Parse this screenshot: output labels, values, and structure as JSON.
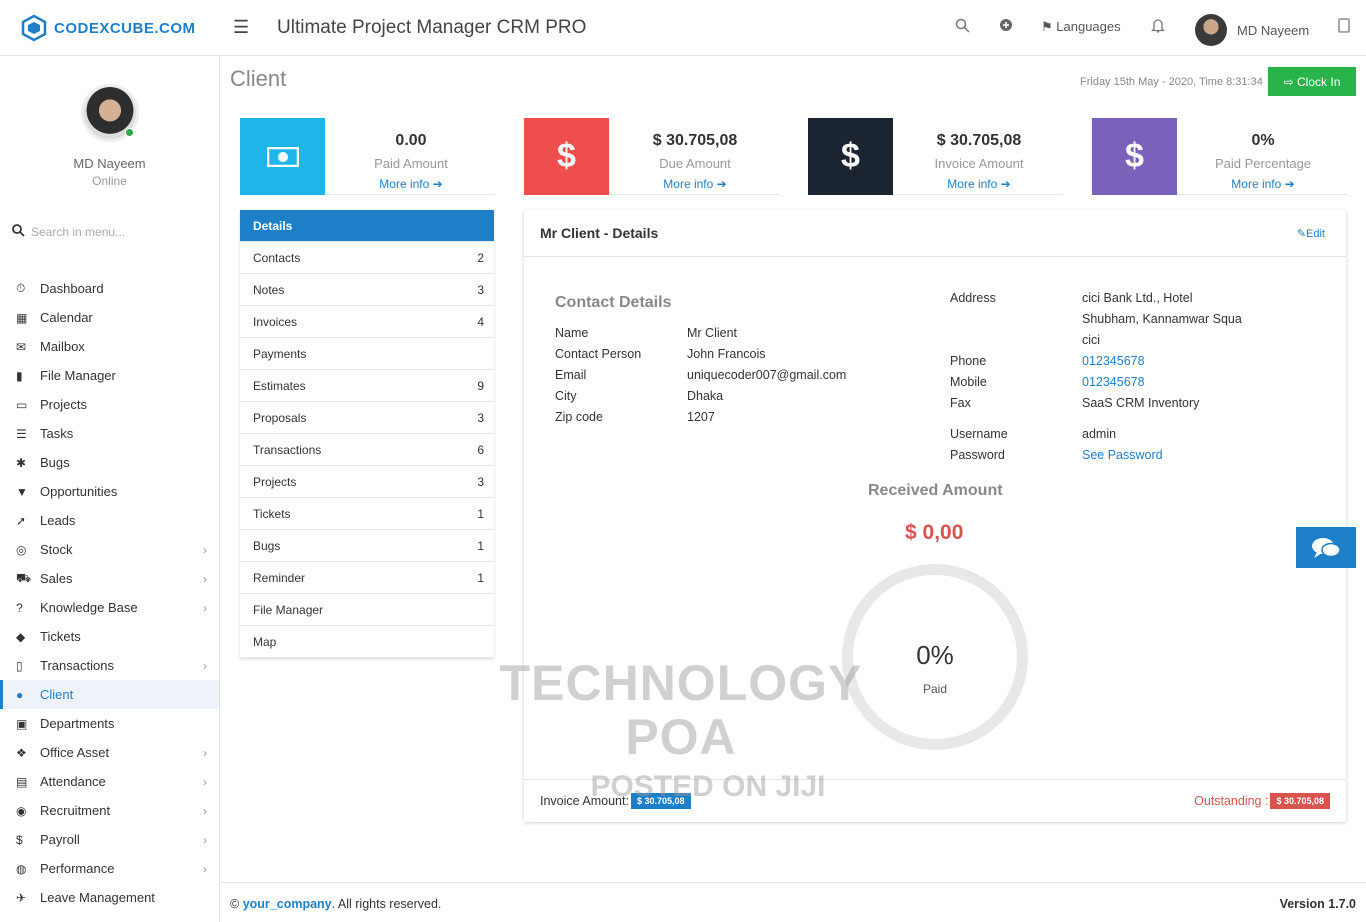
{
  "header": {
    "logo_text": "CODEXCUBE.COM",
    "app_title": "Ultimate Project Manager CRM PRO",
    "languages_label": "Languages",
    "user_name": "MD Nayeem"
  },
  "sidebar": {
    "profile_name": "MD Nayeem",
    "profile_status": "Online",
    "search_placeholder": "Search in menu...",
    "items": [
      {
        "label": "Dashboard",
        "icon": "dashboard-icon"
      },
      {
        "label": "Calendar",
        "icon": "calendar-icon"
      },
      {
        "label": "Mailbox",
        "icon": "mail-icon"
      },
      {
        "label": "File Manager",
        "icon": "file-icon"
      },
      {
        "label": "Projects",
        "icon": "folder-icon"
      },
      {
        "label": "Tasks",
        "icon": "tasks-icon"
      },
      {
        "label": "Bugs",
        "icon": "bug-icon"
      },
      {
        "label": "Opportunities",
        "icon": "filter-icon"
      },
      {
        "label": "Leads",
        "icon": "rocket-icon"
      },
      {
        "label": "Stock",
        "icon": "database-icon"
      },
      {
        "label": "Sales",
        "icon": "cart-icon"
      },
      {
        "label": "Knowledge Base",
        "icon": "question-icon"
      },
      {
        "label": "Tickets",
        "icon": "ticket-icon"
      },
      {
        "label": "Transactions",
        "icon": "building-icon"
      },
      {
        "label": "Client",
        "icon": "users-icon"
      },
      {
        "label": "Departments",
        "icon": "lock-icon"
      },
      {
        "label": "Office Asset",
        "icon": "cube-icon"
      },
      {
        "label": "Attendance",
        "icon": "document-icon"
      },
      {
        "label": "Recruitment",
        "icon": "globe-icon"
      },
      {
        "label": "Payroll",
        "icon": "dollar-icon"
      },
      {
        "label": "Performance",
        "icon": "gauge-icon"
      },
      {
        "label": "Leave Management",
        "icon": "plane-icon"
      }
    ]
  },
  "page": {
    "title": "Client",
    "datetime": "Friday 15th May - 2020,  Time  8:31:34",
    "clockin_label": "Clock In"
  },
  "stats": [
    {
      "value": "0.00",
      "label": "Paid Amount",
      "more": "More info",
      "color": "#1fb5e8"
    },
    {
      "value": "$ 30.705,08",
      "label": "Due Amount",
      "more": "More info",
      "color": "#ef4e4e"
    },
    {
      "value": "$ 30.705,08",
      "label": "Invoice Amount",
      "more": "More info",
      "color": "#1b2431"
    },
    {
      "value": "0%",
      "label": "Paid Percentage",
      "more": "More info",
      "color": "#7a61ba"
    }
  ],
  "tabs": [
    {
      "label": "Details",
      "count": ""
    },
    {
      "label": "Contacts",
      "count": "2"
    },
    {
      "label": "Notes",
      "count": "3"
    },
    {
      "label": "Invoices",
      "count": "4"
    },
    {
      "label": "Payments",
      "count": ""
    },
    {
      "label": "Estimates",
      "count": "9"
    },
    {
      "label": "Proposals",
      "count": "3"
    },
    {
      "label": "Transactions",
      "count": "6"
    },
    {
      "label": "Projects",
      "count": "3"
    },
    {
      "label": "Tickets",
      "count": "1"
    },
    {
      "label": "Bugs",
      "count": "1"
    },
    {
      "label": "Reminder",
      "count": "1"
    },
    {
      "label": "File Manager",
      "count": ""
    },
    {
      "label": "Map",
      "count": ""
    }
  ],
  "details": {
    "title": "Mr Client - Details",
    "edit_label": "Edit",
    "contact_title": "Contact Details",
    "contact": [
      {
        "k": "Name",
        "v": "Mr Client"
      },
      {
        "k": "Contact Person",
        "v": "John Francois"
      },
      {
        "k": "Email",
        "v": "uniquecoder007@gmail.com"
      },
      {
        "k": "City",
        "v": "Dhaka"
      },
      {
        "k": "Zip code",
        "v": "1207"
      }
    ],
    "address_label": "Address",
    "address_lines": [
      "cici Bank Ltd., Hotel",
      "Shubham, Kannamwar Squa",
      "cici"
    ],
    "phone_label": "Phone",
    "phone": "012345678",
    "mobile_label": "Mobile",
    "mobile": "012345678",
    "fax_label": "Fax",
    "fax": "SaaS CRM Inventory",
    "username_label": "Username",
    "username": "admin",
    "password_label": "Password",
    "password_link": "See Password",
    "received_title": "Received Amount",
    "received_amount": "$ 0,00",
    "paid_pct": "0%",
    "paid_label": "Paid",
    "invoice_amount_label": "Invoice Amount:",
    "invoice_amount": "$ 30.705,08",
    "outstanding_label": "Outstanding :",
    "outstanding": "$ 30.705,08"
  },
  "watermark": {
    "line1": "TECHNOLOGY POA",
    "line2": "POSTED ON JIJI"
  },
  "footer": {
    "copyright_symbol": "©",
    "company": "your_company",
    "rights": "All rights reserved.",
    "version": "Version 1.7.0"
  }
}
